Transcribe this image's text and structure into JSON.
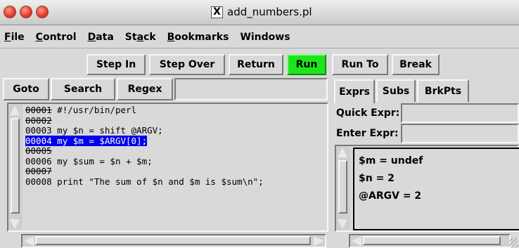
{
  "window": {
    "title": "add_numbers.pl",
    "app_icon": "x11-icon"
  },
  "menubar": [
    "File",
    "Control",
    "Data",
    "Stack",
    "Bookmarks",
    "Windows"
  ],
  "toolbar": {
    "step_in": "Step In",
    "step_over": "Step Over",
    "return": "Return",
    "run": "Run",
    "run_to": "Run To",
    "break": "Break"
  },
  "search_bar": {
    "goto": "Goto",
    "search": "Search",
    "regex": "Regex",
    "value": ""
  },
  "source": {
    "lines": [
      {
        "num": "00001",
        "text": " #!/usr/bin/perl",
        "breakpointable": true,
        "selected": false
      },
      {
        "num": "00002",
        "text": "",
        "breakpointable": true,
        "selected": false
      },
      {
        "num": "00003",
        "text": " my $n = shift @ARGV;",
        "breakpointable": false,
        "selected": false
      },
      {
        "num": "00004",
        "text": " my $m = $ARGV[0];",
        "breakpointable": false,
        "selected": true
      },
      {
        "num": "00005",
        "text": "",
        "breakpointable": true,
        "selected": false
      },
      {
        "num": "00006",
        "text": " my $sum = $n + $m;",
        "breakpointable": false,
        "selected": false
      },
      {
        "num": "00007",
        "text": "",
        "breakpointable": true,
        "selected": false
      },
      {
        "num": "00008",
        "text": " print \"The sum of $n and $m is $sum\\n\";",
        "breakpointable": false,
        "selected": false
      }
    ]
  },
  "tabs": {
    "exprs": "Exprs",
    "subs": "Subs",
    "brkpts": "BrkPts"
  },
  "expressions": {
    "quick_label": "Quick Expr:",
    "quick_value": "",
    "enter_label": "Enter Expr:",
    "enter_value": "",
    "items": [
      "$m = undef",
      "$n = 2",
      "@ARGV = 2"
    ]
  },
  "colors": {
    "run_button": "#1ee41e",
    "selection": "#0000e8",
    "chrome": "#d9d9d9"
  }
}
